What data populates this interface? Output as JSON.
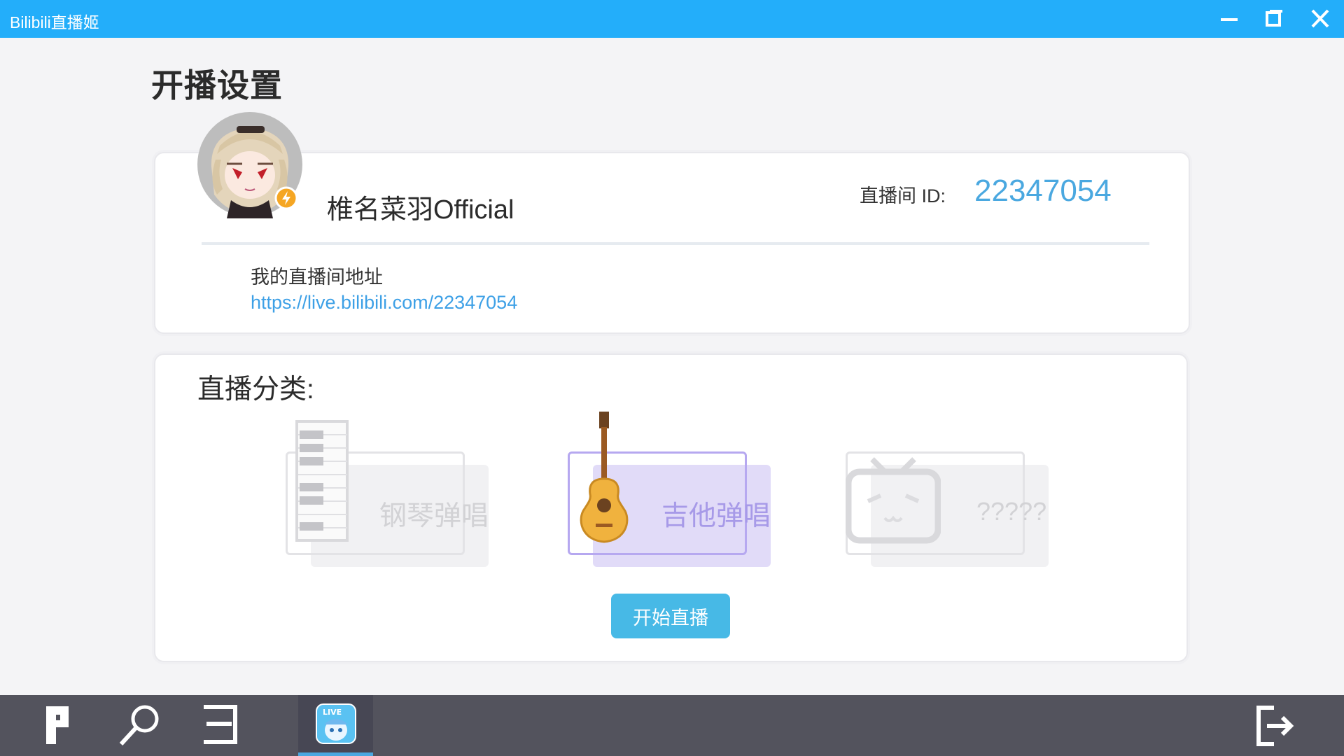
{
  "window": {
    "title": "Bilibili直播姬"
  },
  "page": {
    "title": "开播设置"
  },
  "profile": {
    "name": "椎名菜羽Official",
    "room_id_label": "直播间 ID:",
    "room_id": "22347054",
    "address_label": "我的直播间地址",
    "address_url": "https://live.bilibili.com/22347054"
  },
  "category": {
    "label": "直播分类:",
    "options": [
      {
        "label": "钢琴弹唱",
        "icon": "piano-icon",
        "selected": false
      },
      {
        "label": "吉他弹唱",
        "icon": "guitar-icon",
        "selected": true
      },
      {
        "label": "?????",
        "icon": "bilibili-tv-icon",
        "selected": false
      }
    ]
  },
  "actions": {
    "start_label": "开始直播"
  },
  "taskbar": {
    "items": [
      "p-icon",
      "search-icon",
      "layout-icon",
      "live-app-icon"
    ],
    "exit_icon": "exit-icon"
  },
  "colors": {
    "titlebar": "#23aefa",
    "accent": "#4aa8e0",
    "selected_tile": "#e1dbf8",
    "selected_border": "#b6a8f0",
    "start_button": "#47b9e6",
    "taskbar": "#53535d"
  }
}
